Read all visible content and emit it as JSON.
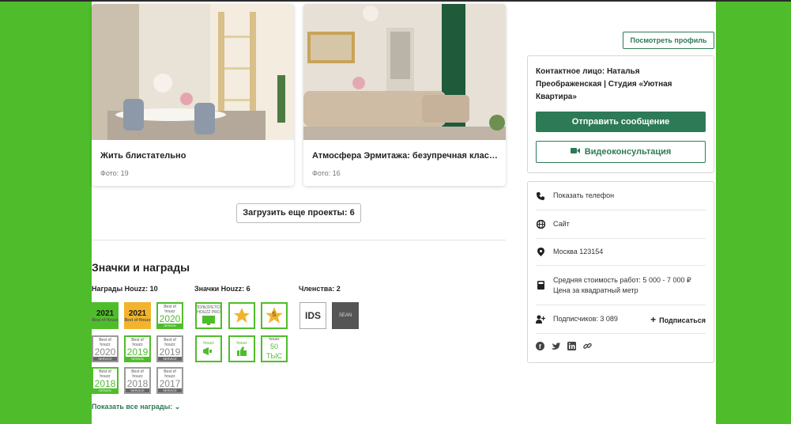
{
  "projects": [
    {
      "title": "Жить блистательно",
      "photos": "Фото: 19"
    },
    {
      "title": "Атмосфера Эрмитажа: безупречная класс…",
      "photos": "Фото: 16"
    }
  ],
  "load_more_label": "Загрузить еще проекты: 6",
  "awards": {
    "section_title": "Значки и награды",
    "houzz_awards_title": "Награды Houzz: 10",
    "houzz_badges_title": "Значки Houzz: 6",
    "memberships_title": "Членства: 2",
    "award_badges": [
      {
        "year": "2021",
        "line": "Best of Houzz"
      },
      {
        "year": "2021",
        "line": "Best of Houzz"
      },
      {
        "year": "2020",
        "label": "DESIGN",
        "top": "Best of",
        "brand": "houzz"
      },
      {
        "year": "2020",
        "label": "SERVICE",
        "top": "Best of",
        "brand": "houzz"
      },
      {
        "year": "2019",
        "label": "DESIGN",
        "top": "Best of",
        "brand": "houzz"
      },
      {
        "year": "2019",
        "label": "SERVICE",
        "top": "Best of",
        "brand": "houzz"
      },
      {
        "year": "2018",
        "label": "DESIGN",
        "top": "Best of",
        "brand": "houzz"
      },
      {
        "year": "2018",
        "label": "SERVICE",
        "top": "Best of",
        "brand": "houzz"
      },
      {
        "year": "2017",
        "label": "SERVICE",
        "top": "Best of",
        "brand": "houzz"
      }
    ],
    "houzz_badges": [
      {
        "text": "ПОЛЬЗУЕТСЯ HOUZZ PRO"
      },
      {
        "text": "★"
      },
      {
        "text": "5"
      },
      {
        "text": "houzz"
      },
      {
        "text": "houzz"
      },
      {
        "text": "50 ТЫС"
      }
    ],
    "memberships": [
      {
        "text": "IDS"
      },
      {
        "text": "SEAN"
      }
    ],
    "show_all_label": "Показать все награды: ⌄"
  },
  "sidebar": {
    "profile_button": "Посмотреть профиль",
    "contact_name": "Контактное лицо: Наталья Преображенская | Студия «Уютная Квартира»",
    "send_message": "Отправить сообщение",
    "video_consult": "Видеоконсультация",
    "show_phone": "Показать телефон",
    "website": "Сайт",
    "location": "Москва 123154",
    "cost": "Средняя стоимость работ: 5 000 - 7 000 ₽",
    "cost_unit": "Цена за квадратный метр",
    "followers": "Подписчиков: 3 089",
    "subscribe": "Подписаться",
    "social_icons": [
      "facebook-icon",
      "twitter-icon",
      "linkedin-icon",
      "link-icon"
    ]
  },
  "colors": {
    "brand_green": "#2d7a56",
    "page_bg": "#4fbd2b",
    "award_yellow": "#f1b42c"
  }
}
